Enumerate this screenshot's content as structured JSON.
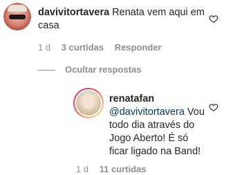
{
  "comment1": {
    "username": "davivitortavera",
    "text": "Renata vem aqui em casa",
    "time": "1 d",
    "likes": "3 curtidas",
    "reply": "Responder"
  },
  "replies": {
    "toggle_label": "Ocultar respostas"
  },
  "comment2": {
    "username": "renatafan",
    "mention": "@davivitortavera",
    "text": "Vou todo dia através do Jogo Aberto! É só ficar ligado na Band!",
    "time": "1 d",
    "likes": "11 curtidas"
  },
  "icons": {
    "like": "heart-icon"
  }
}
